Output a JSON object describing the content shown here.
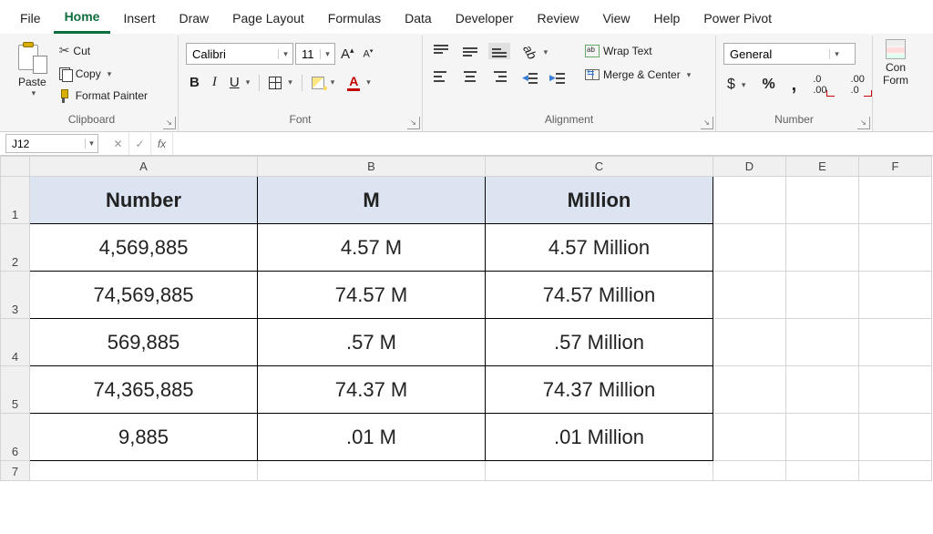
{
  "menu": {
    "items": [
      "File",
      "Home",
      "Insert",
      "Draw",
      "Page Layout",
      "Formulas",
      "Data",
      "Developer",
      "Review",
      "View",
      "Help",
      "Power Pivot"
    ],
    "active": "Home"
  },
  "ribbon": {
    "clipboard": {
      "label": "Clipboard",
      "paste": "Paste",
      "cut": "Cut",
      "copy": "Copy",
      "format_painter": "Format Painter"
    },
    "font": {
      "label": "Font",
      "name": "Calibri",
      "size": "11"
    },
    "alignment": {
      "label": "Alignment",
      "wrap": "Wrap Text",
      "merge": "Merge & Center"
    },
    "number": {
      "label": "Number",
      "format": "General",
      "currency": "$",
      "percent": "%",
      "comma": ","
    },
    "cond": {
      "label1": "Con",
      "label2": "Form"
    }
  },
  "formula_bar": {
    "name_box": "J12",
    "cancel": "✕",
    "enter": "✓",
    "fx": "fx",
    "formula": ""
  },
  "columns": [
    "A",
    "B",
    "C",
    "D",
    "E",
    "F"
  ],
  "rows": [
    "1",
    "2",
    "3",
    "4",
    "5",
    "6",
    "7"
  ],
  "table": {
    "headers": [
      "Number",
      "M",
      "Million"
    ],
    "data": [
      [
        "4,569,885",
        "4.57 M",
        "4.57 Million"
      ],
      [
        "74,569,885",
        "74.57 M",
        "74.57 Million"
      ],
      [
        "569,885",
        ".57 M",
        ".57 Million"
      ],
      [
        "74,365,885",
        "74.37 M",
        "74.37 Million"
      ],
      [
        "9,885",
        ".01 M",
        ".01 Million"
      ]
    ]
  }
}
